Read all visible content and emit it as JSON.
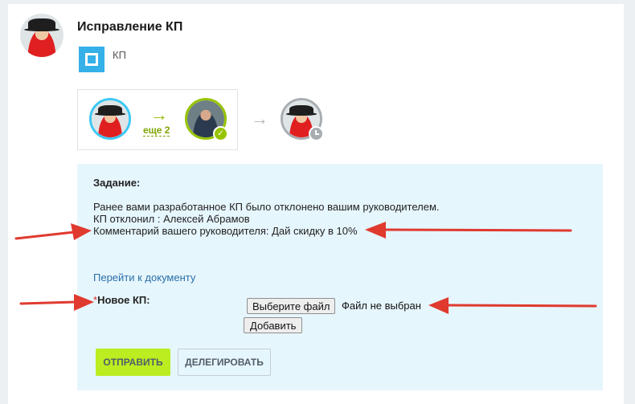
{
  "header": {
    "title": "Исправление КП"
  },
  "document": {
    "label": "КП",
    "icon": "document-icon"
  },
  "route": {
    "more_link": "еще 2"
  },
  "task": {
    "heading": "Задание:",
    "lines": [
      "Ранее вами разработанное КП было отклонено вашим руководителем.",
      "КП отклонил : Алексей Абрамов",
      "Комментарий вашего руководителя: Дай скидку в 10%"
    ],
    "document_link": "Перейти к документу",
    "field": {
      "required_mark": "*",
      "label": "Новое КП:",
      "choose_file_button": "Выберите файл",
      "file_status": "Файл не выбран",
      "add_button": "Добавить"
    },
    "actions": {
      "send": "ОТПРАВИТЬ",
      "delegate": "ДЕЛЕГИРОВАТЬ"
    }
  },
  "colors": {
    "accent_green": "#bbed21",
    "task_background": "#e6f6fd",
    "link_blue": "#2a6fa8",
    "annotation_red": "#e03a2f"
  }
}
